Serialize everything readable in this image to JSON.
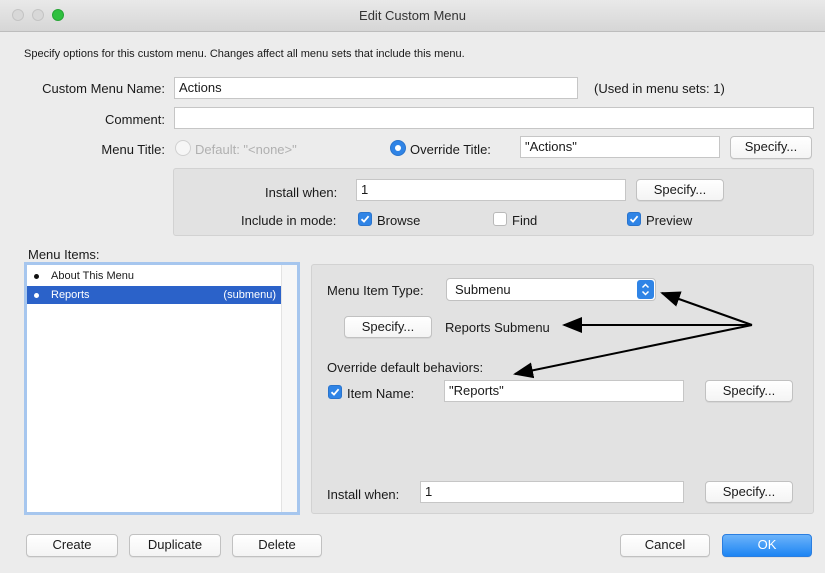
{
  "window": {
    "title": "Edit Custom Menu"
  },
  "description": "Specify options for this custom menu.  Changes affect all menu sets that include this menu.",
  "custom_menu_name": {
    "label": "Custom Menu Name:",
    "value": "Actions",
    "used_in": "(Used in menu sets: 1)"
  },
  "comment": {
    "label": "Comment:",
    "value": ""
  },
  "menu_title": {
    "label": "Menu Title:",
    "default_label": "Default: \"<none>\"",
    "default_selected": false,
    "override_label": "Override Title:",
    "override_selected": true,
    "override_value": "\"Actions\"",
    "specify_label": "Specify..."
  },
  "install": {
    "label": "Install when:",
    "value": "1",
    "specify_label": "Specify...",
    "mode_label": "Include in mode:",
    "modes": [
      {
        "label": "Browse",
        "checked": true
      },
      {
        "label": "Find",
        "checked": false
      },
      {
        "label": "Preview",
        "checked": true
      }
    ]
  },
  "menu_items": {
    "label": "Menu Items:",
    "items": [
      {
        "name": "About This Menu",
        "type": ""
      },
      {
        "name": "Reports",
        "type": "(submenu)"
      }
    ],
    "selected_index": 1
  },
  "item_detail": {
    "type_label": "Menu Item Type:",
    "type_value": "Submenu",
    "specify_label": "Specify...",
    "submenu_name": "Reports Submenu",
    "override_label": "Override default behaviors:",
    "item_name_label": "Item Name:",
    "item_name_checked": true,
    "item_name_value": "\"Reports\"",
    "item_specify_label": "Specify...",
    "install_label": "Install when:",
    "install_value": "1",
    "install_specify_label": "Specify..."
  },
  "buttons": {
    "create": "Create",
    "duplicate": "Duplicate",
    "delete": "Delete",
    "cancel": "Cancel",
    "ok": "OK"
  },
  "colors": {
    "accent": "#2f84e6",
    "selection": "#2b62c9",
    "list_border": "#a6c6ee"
  }
}
